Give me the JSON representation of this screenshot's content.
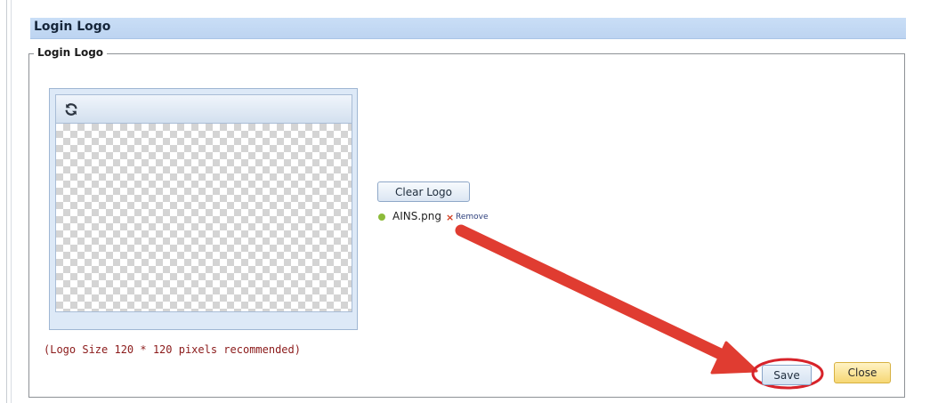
{
  "page": {
    "title": "Login Logo"
  },
  "fieldset": {
    "legend": "Login Logo"
  },
  "logo_panel": {
    "refresh_icon": "refresh-icon"
  },
  "size_note": "(Logo Size 120 * 120 pixels recommended)",
  "upload": {
    "clear_label": "Clear Logo",
    "file_name": "AINS.png",
    "remove_mark": "×",
    "remove_label": "Remove",
    "status_color": "#8dbb3a"
  },
  "actions": {
    "save_label": "Save",
    "close_label": "Close"
  },
  "annotation": {
    "arrow_color": "#e03c31",
    "circle_color": "#d7232a"
  }
}
